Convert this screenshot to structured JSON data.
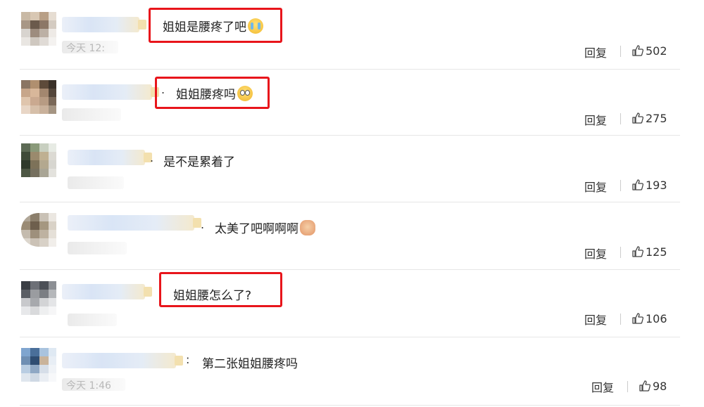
{
  "comments": [
    {
      "text": "姐姐是腰疼了吧",
      "emoji": "crying-face-icon",
      "highlighted": true,
      "time_fragment": "今天 12:",
      "reply_label": "回复",
      "likes": "502"
    },
    {
      "text": "姐姐腰疼吗",
      "emoji": "sad-face-icon",
      "highlighted": true,
      "time_fragment": "",
      "reply_label": "回复",
      "likes": "275"
    },
    {
      "text": "是不是累着了",
      "emoji": "",
      "highlighted": false,
      "time_fragment": "",
      "reply_label": "回复",
      "likes": "193"
    },
    {
      "text": "太美了吧啊啊啊",
      "emoji": "doge-face-icon",
      "highlighted": false,
      "time_fragment": "",
      "reply_label": "回复",
      "likes": "125"
    },
    {
      "text": "姐姐腰怎么了?",
      "emoji": "",
      "highlighted": true,
      "time_fragment": "",
      "reply_label": "回复",
      "likes": "106"
    },
    {
      "text": "第二张姐姐腰疼吗",
      "emoji": "",
      "highlighted": false,
      "time_fragment": "今天 1:46",
      "reply_label": "回复",
      "likes": "98"
    }
  ],
  "colors": {
    "highlight_border": "#e8151b",
    "divider": "#e6e6e6",
    "text": "#222222"
  }
}
